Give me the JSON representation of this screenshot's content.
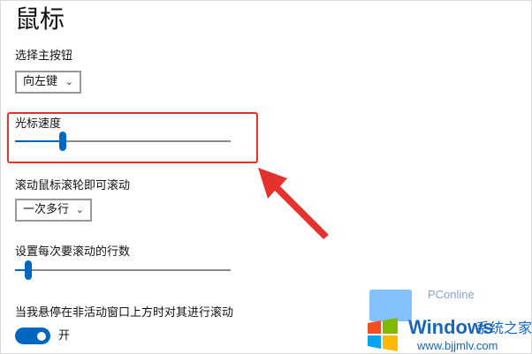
{
  "page": {
    "title": "鼠标"
  },
  "primary_button": {
    "label": "选择主按钮",
    "value": "向左键"
  },
  "pointer_speed": {
    "label": "光标速度",
    "level_fraction": 0.22
  },
  "scroll_mode": {
    "label": "滚动鼠标滚轮即可滚动",
    "value": "一次多行"
  },
  "scroll_lines": {
    "label": "设置每次要滚动的行数",
    "level_fraction": 0.06
  },
  "inactive_scroll": {
    "label": "当我悬停在非活动窗口上方时对其进行滚动",
    "toggle_text": "开",
    "on": true
  },
  "colors": {
    "accent": "#0067c0",
    "annotation_red": "#e5322d",
    "watermark_blue": "#1a67b8"
  },
  "watermark": {
    "site": "PConline",
    "brand": "Windows",
    "brand_suffix": "系统之家",
    "url": "www.bjjmlv.com"
  }
}
